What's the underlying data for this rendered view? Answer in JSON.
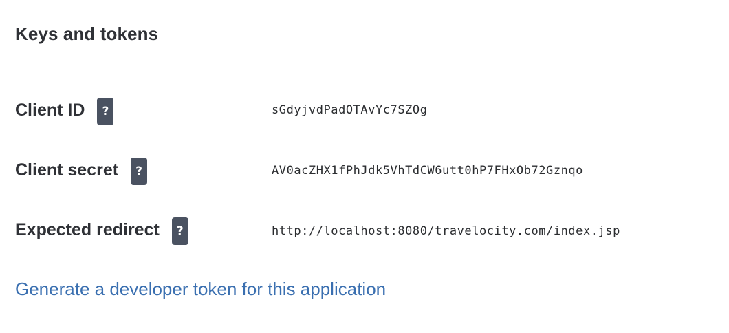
{
  "section": {
    "title": "Keys and tokens"
  },
  "fields": [
    {
      "label": "Client ID",
      "help_icon": "?",
      "value": "sGdyjvdPadOTAvYc7SZOg"
    },
    {
      "label": "Client secret",
      "help_icon": "?",
      "value": "AV0acZHX1fPhJdk5VhTdCW6utt0hP7FHxOb72Gznqo"
    },
    {
      "label": "Expected redirect",
      "help_icon": "?",
      "value": "http://localhost:8080/travelocity.com/index.jsp"
    }
  ],
  "links": {
    "generate_token": "Generate a developer token for this application"
  },
  "colors": {
    "text": "#2f3136",
    "badge_bg": "#4a5261",
    "link": "#3a6fb0"
  },
  "icons": {
    "help": "question-mark-help-icon"
  }
}
